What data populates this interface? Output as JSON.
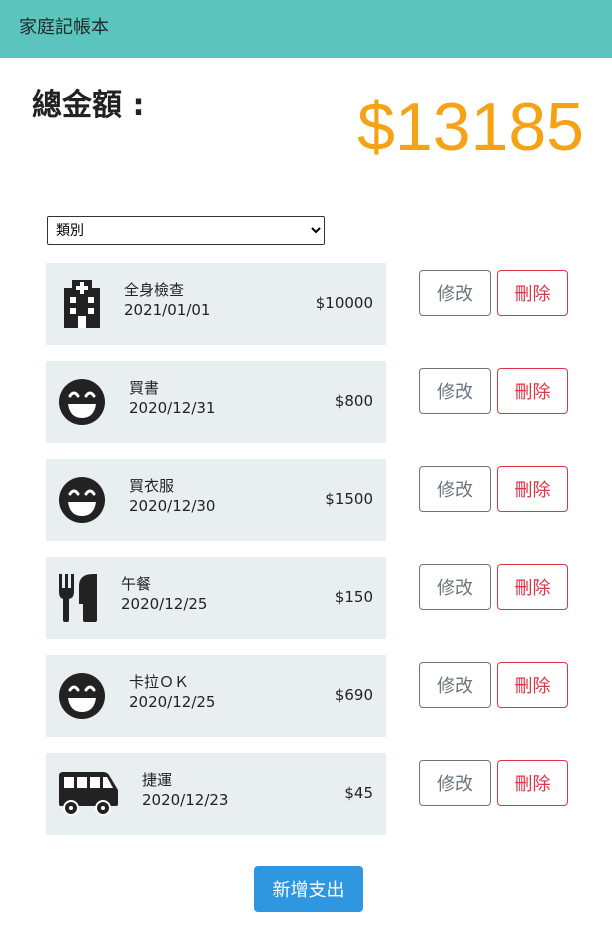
{
  "app": {
    "title": "家庭記帳本"
  },
  "summary": {
    "label": "總金額 :",
    "total": "$13185"
  },
  "filter": {
    "selected": "類別"
  },
  "actions": {
    "edit_label": "修改",
    "delete_label": "刪除",
    "add_label": "新增支出"
  },
  "records": [
    {
      "icon": "hospital-icon",
      "name": "全身檢查",
      "date": "2021/01/01",
      "amount": "$10000"
    },
    {
      "icon": "smile-icon",
      "name": "買書",
      "date": "2020/12/31",
      "amount": "$800"
    },
    {
      "icon": "smile-icon",
      "name": "買衣服",
      "date": "2020/12/30",
      "amount": "$1500"
    },
    {
      "icon": "utensils-icon",
      "name": "午餐",
      "date": "2020/12/25",
      "amount": "$150"
    },
    {
      "icon": "smile-icon",
      "name": "卡拉ＯＫ",
      "date": "2020/12/25",
      "amount": "$690"
    },
    {
      "icon": "bus-icon",
      "name": "捷運",
      "date": "2020/12/23",
      "amount": "$45"
    }
  ],
  "colors": {
    "navbar": "#5bc4bd",
    "total": "#f5a214",
    "record_bg": "#e9eef0",
    "edit": "#6c757d",
    "delete": "#dc3545",
    "add_button": "#2f96e0"
  }
}
